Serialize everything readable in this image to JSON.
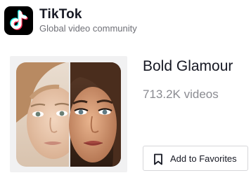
{
  "brand": {
    "title": "TikTok",
    "subtitle": "Global video community",
    "logo_icon": "tiktok-note-logo",
    "colors": {
      "logo_bg": "#000000",
      "cyan": "#25f4ee",
      "pink": "#fe2c55"
    }
  },
  "effect": {
    "name": "Bold Glamour",
    "video_count": "713.2K videos",
    "thumbnail": "before-after-face-filter-image"
  },
  "actions": {
    "favorite_label": "Add to Favorites",
    "favorite_icon": "bookmark-icon"
  }
}
